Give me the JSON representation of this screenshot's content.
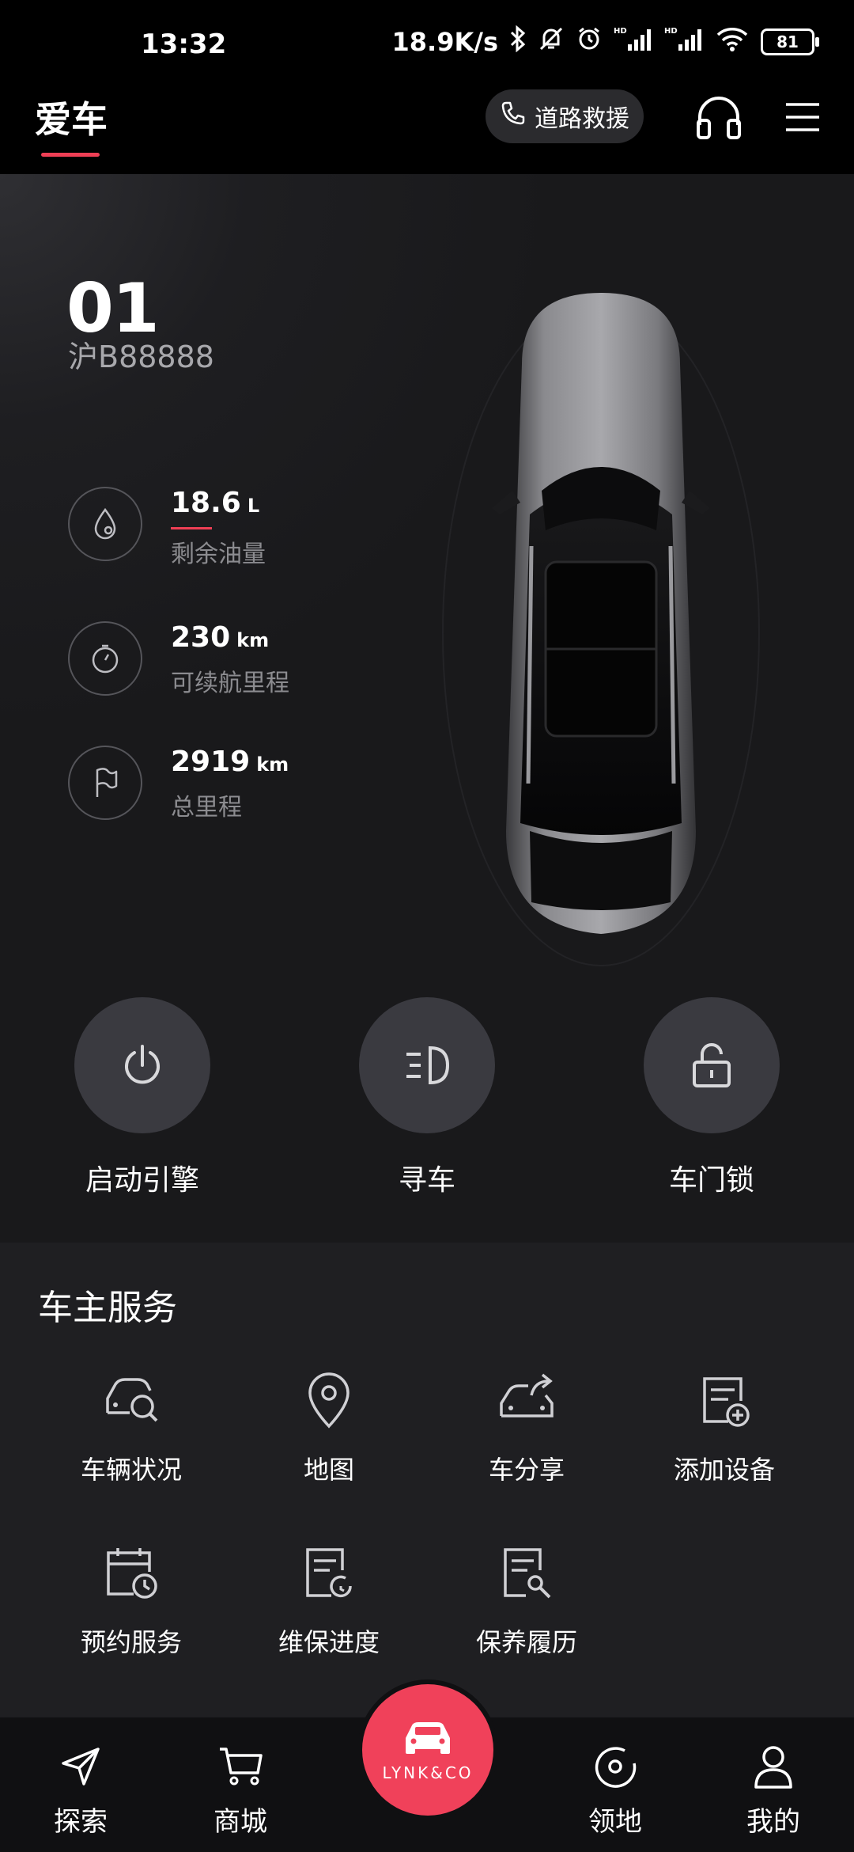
{
  "status_bar": {
    "time": "13:32",
    "network_speed": "18.9K/s",
    "battery": "81"
  },
  "header": {
    "title": "爱车",
    "rescue_label": "道路救援"
  },
  "vehicle": {
    "model": "01",
    "plate": "沪B88888"
  },
  "stats": [
    {
      "value": "18.6",
      "unit": "L",
      "label": "剩余油量",
      "icon": "fuel-drop-icon"
    },
    {
      "value": "230",
      "unit": "km",
      "label": "可续航里程",
      "icon": "timer-icon"
    },
    {
      "value": "2919",
      "unit": "km",
      "label": "总里程",
      "icon": "flag-icon"
    }
  ],
  "actions": [
    {
      "label": "启动引擎",
      "icon": "power-icon"
    },
    {
      "label": "寻车",
      "icon": "headlight-icon"
    },
    {
      "label": "车门锁",
      "icon": "unlock-icon"
    }
  ],
  "services": {
    "title": "车主服务",
    "items": [
      {
        "label": "车辆状况",
        "icon": "car-search-icon"
      },
      {
        "label": "地图",
        "icon": "map-pin-icon"
      },
      {
        "label": "车分享",
        "icon": "car-share-icon"
      },
      {
        "label": "添加设备",
        "icon": "add-device-icon"
      },
      {
        "label": "预约服务",
        "icon": "calendar-clock-icon"
      },
      {
        "label": "维保进度",
        "icon": "maintenance-progress-icon"
      },
      {
        "label": "保养履历",
        "icon": "maintenance-history-icon"
      }
    ]
  },
  "bottom_nav": {
    "items": [
      {
        "label": "探索",
        "icon": "send-icon"
      },
      {
        "label": "商城",
        "icon": "cart-icon"
      },
      {
        "label": "领地",
        "icon": "target-icon"
      },
      {
        "label": "我的",
        "icon": "person-icon"
      }
    ],
    "center_logo": "LYNK&CO"
  },
  "colors": {
    "accent": "#ef3f55",
    "background": "#19191b",
    "panel": "#1f1f22"
  }
}
